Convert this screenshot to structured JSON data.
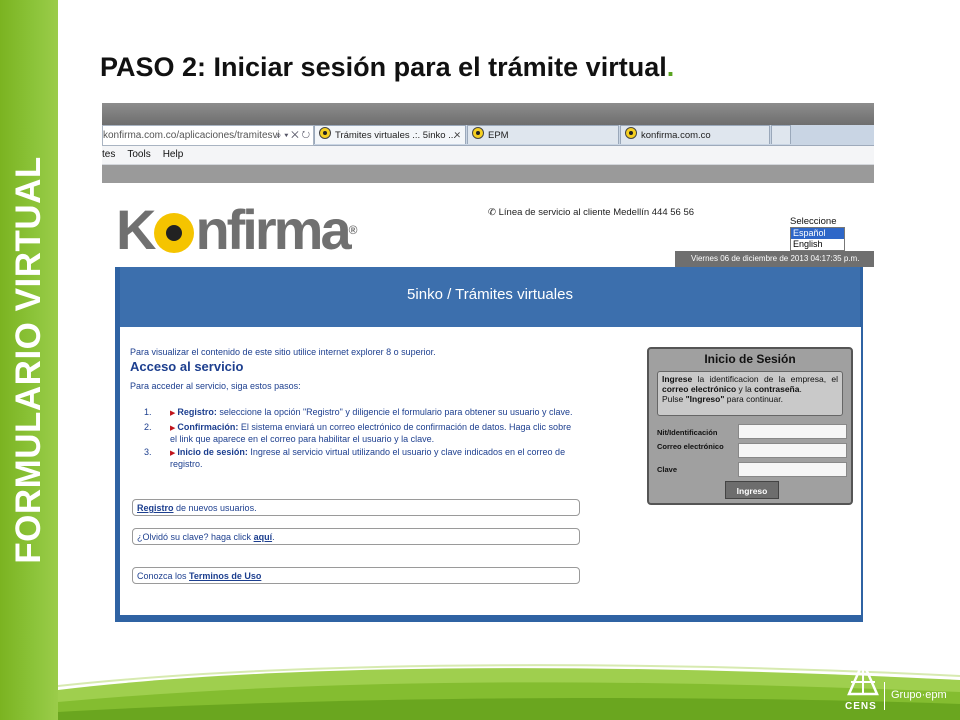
{
  "slide": {
    "side_label": "FORMULARIO VIRTUAL",
    "title": "PASO 2: Iniciar sesión para el trámite virtual",
    "title_dot": ".",
    "footer": {
      "cens": "CENS",
      "grupo": "Grupo·epm"
    }
  },
  "browser": {
    "address": "konfirma.com.co/aplicaciones/tramitesvi",
    "tabs": [
      {
        "label": "Trámites virtuales .:. 5inko ..."
      },
      {
        "label": "EPM"
      },
      {
        "label": "konfirma.com.co"
      }
    ],
    "menu": [
      "tes",
      "Tools",
      "Help"
    ]
  },
  "site": {
    "logo_left": "K",
    "logo_right": "nfirma",
    "logo_mark": "®",
    "phone": "Línea de servicio al cliente Medellín 444 56 56",
    "language": {
      "label": "Seleccione",
      "options": [
        "Español",
        "English"
      ],
      "selected": "Español"
    },
    "date": "Viernes 06 de diciembre de 2013 04:17:35 p.m.",
    "header": "5inko / Trámites virtuales",
    "intro": "Para visualizar el contenido de este sitio utilice internet explorer 8 o superior.",
    "acceso_title": "Acceso al servicio",
    "acceso_para": "Para acceder al servicio, siga estos pasos:",
    "steps": [
      {
        "num": "1.",
        "bold": "Registro:",
        "text": " seleccione la opción \"Registro\" y diligencie el formulario para obtener su usuario y clave."
      },
      {
        "num": "2.",
        "bold": "Confirmación:",
        "text": " El sistema enviará un correo electrónico de confirmación de datos. Haga clic sobre el link que aparece en el correo para habilitar el usuario y la clave."
      },
      {
        "num": "3.",
        "bold": "Inicio de sesión:",
        "text": " Ingrese al servicio virtual utilizando el usuario y clave indicados en el correo de registro."
      }
    ],
    "links": {
      "registro_link": "Registro",
      "registro_rest": " de nuevos usuarios.",
      "olvido_pre": "¿Olvidó su clave? haga click ",
      "olvido_link": "aquí",
      "olvido_post": ".",
      "terminos_pre": "Conozca los ",
      "terminos_link": "Terminos de Uso"
    },
    "login": {
      "title": "Inicio de Sesión",
      "note_1": "Ingrese",
      "note_2": " la identificacion de la empresa, el ",
      "note_3": "correo electrónico",
      "note_4": " y la ",
      "note_5": "contraseña",
      "note_6": ".",
      "note_7": "Pulse ",
      "note_8": "\"Ingreso\"",
      "note_9": " para continuar.",
      "nit_label": "Nit/Identificación",
      "correo_label": "Correo electrónico",
      "clave_label": "Clave",
      "nit_value": "",
      "correo_value": "",
      "clave_value": "",
      "button": "Ingreso"
    }
  }
}
